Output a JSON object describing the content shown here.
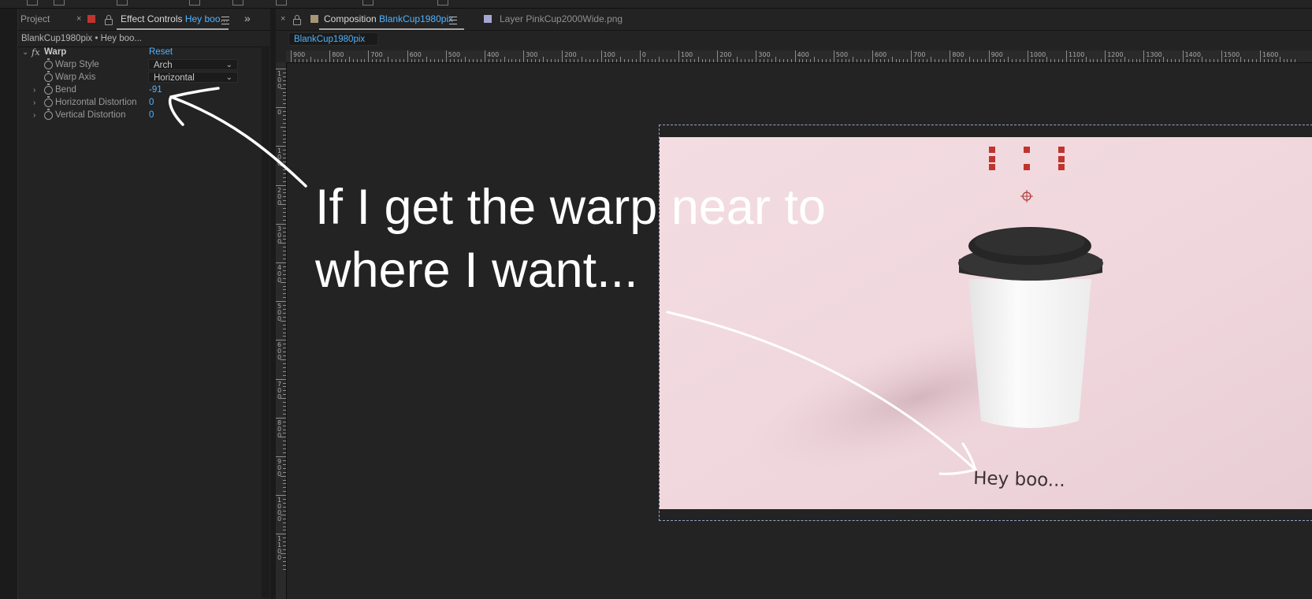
{
  "left_panel": {
    "tab_project": "Project",
    "tab_effect_controls": "Effect Controls",
    "tab_effect_controls_layer": "Hey boo...",
    "panel_path": "BlankCup1980pix • Hey boo...",
    "effect": {
      "fx_label": "fx",
      "name": "Warp",
      "reset_label": "Reset",
      "params": {
        "warp_style": {
          "label": "Warp Style",
          "value": "Arch"
        },
        "warp_axis": {
          "label": "Warp Axis",
          "value": "Horizontal"
        },
        "bend": {
          "label": "Bend",
          "value": "-91"
        },
        "horizontal_distortion": {
          "label": "Horizontal Distortion",
          "value": "0"
        },
        "vertical_distortion": {
          "label": "Vertical Distortion",
          "value": "0"
        }
      }
    }
  },
  "comp_panel": {
    "tab_composition": "Composition",
    "tab_composition_name": "BlankCup1980pix",
    "tab_layer": "Layer PinkCup2000Wide.png",
    "active_comp_chip": "BlankCup1980pix",
    "ruler_top_labels": [
      "900",
      "800",
      "700",
      "600",
      "500",
      "400",
      "300",
      "200",
      "100",
      "0",
      "100",
      "200",
      "300",
      "400",
      "500",
      "600",
      "700",
      "800",
      "900",
      "1000",
      "1100",
      "1200",
      "1300",
      "1400",
      "1500",
      "1600"
    ],
    "ruler_left_labels": [
      "100",
      "0",
      "100",
      "200",
      "300",
      "400",
      "500",
      "600",
      "700",
      "800",
      "900",
      "1000",
      "1100"
    ]
  },
  "annotation": {
    "line1": "If I get the warp near to",
    "line2": "where I want..."
  },
  "comp_content": {
    "cup_text": "Hey boo..."
  },
  "colors": {
    "accent": "#4fb3ff",
    "panel_bg": "#232323",
    "comp_bg": "#f1d8de",
    "cup_lid": "#2b2b2b",
    "handle_red": "#c0342f"
  }
}
